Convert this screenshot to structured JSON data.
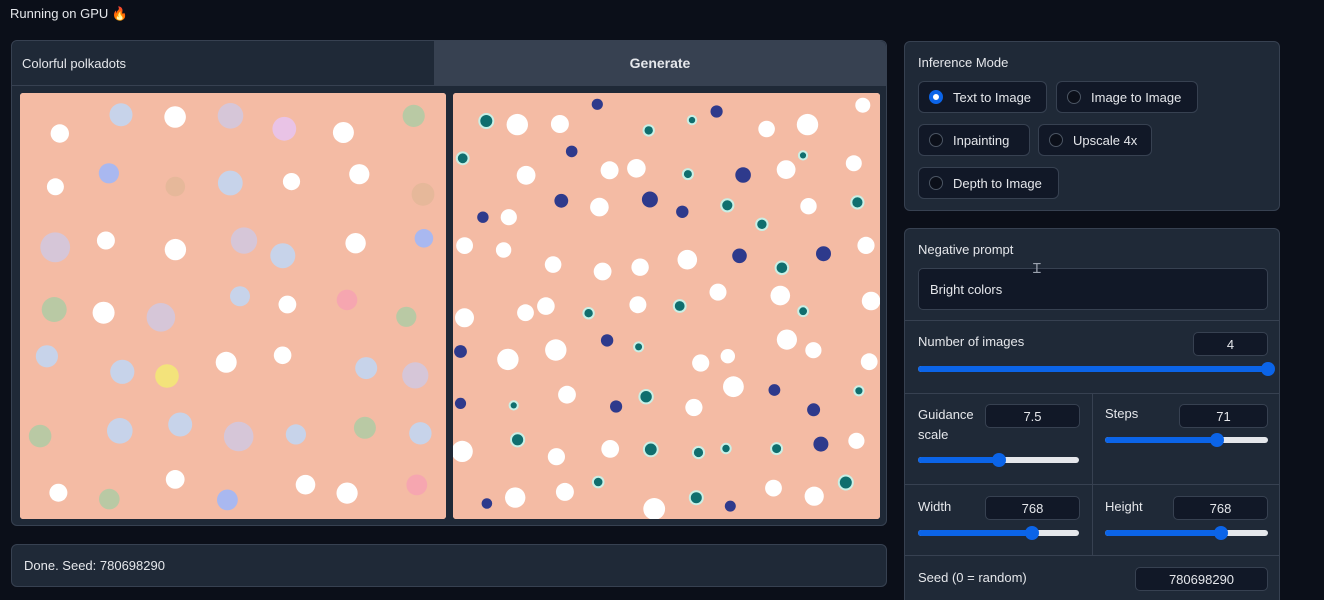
{
  "app": {
    "status_text": "Running on GPU 🔥"
  },
  "prompt": {
    "value": "Colorful polkadots",
    "generate_label": "Generate"
  },
  "gallery": {
    "images": [
      "generated-image-1",
      "generated-image-2"
    ]
  },
  "status": {
    "text": "Done. Seed: 780698290"
  },
  "inference_mode": {
    "label": "Inference Mode",
    "options": [
      "Text to Image",
      "Image to Image",
      "Inpainting",
      "Upscale 4x",
      "Depth to Image"
    ],
    "selected": "Text to Image"
  },
  "negative_prompt": {
    "label": "Negative prompt",
    "value": "Bright colors"
  },
  "num_images": {
    "label": "Number of images",
    "value": "4",
    "level": 1.0
  },
  "guidance": {
    "label_line1": "Guidance",
    "label_line2": "scale",
    "value": "7.5",
    "level": 0.5
  },
  "steps": {
    "label": "Steps",
    "value": "71",
    "level": 0.7
  },
  "width": {
    "label": "Width",
    "value": "768",
    "level": 0.7
  },
  "height": {
    "label": "Height",
    "value": "768",
    "level": 0.7
  },
  "seed": {
    "label": "Seed (0 = random)",
    "value": "780698290"
  },
  "colors": {
    "bg": "#0b0f19",
    "panel": "#1f2937",
    "accent": "#0b64e8",
    "image_bg": "#f4bba4"
  }
}
